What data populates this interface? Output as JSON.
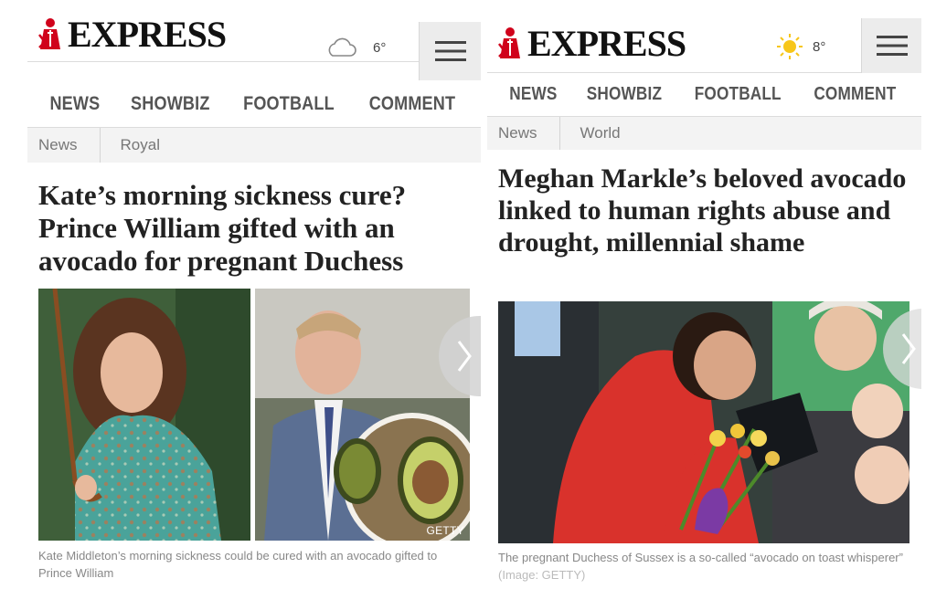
{
  "left": {
    "logo_text": "EXPRESS",
    "weather": {
      "icon": "cloud-icon",
      "temp": "6°"
    },
    "nav": [
      "NEWS",
      "SHOWBIZ",
      "FOOTBALL",
      "COMMENT"
    ],
    "breadcrumb": [
      "News",
      "Royal"
    ],
    "headline": "Kate’s morning sickness cure? Prince William gifted with an avocado for pregnant Duchess",
    "image_credit": "GETTY",
    "caption": "Kate Middleton’s morning sickness could be cured with an avocado gifted to Prince William"
  },
  "right": {
    "logo_text": "EXPRESS",
    "weather": {
      "icon": "sun-icon",
      "temp": "8°"
    },
    "nav": [
      "NEWS",
      "SHOWBIZ",
      "FOOTBALL",
      "COMMENT"
    ],
    "breadcrumb": [
      "News",
      "World"
    ],
    "headline": "Meghan Markle’s beloved avocado linked to human rights abuse and drought, millennial shame",
    "caption": "The pregnant Duchess of Sussex is a so-called “avocado on toast whisperer”",
    "caption_credit": "(Image: GETTY)"
  },
  "colors": {
    "brand_red": "#d0021b",
    "sun_yellow": "#f7c61a",
    "text_dark": "#222222",
    "nav_grey": "#555555"
  }
}
